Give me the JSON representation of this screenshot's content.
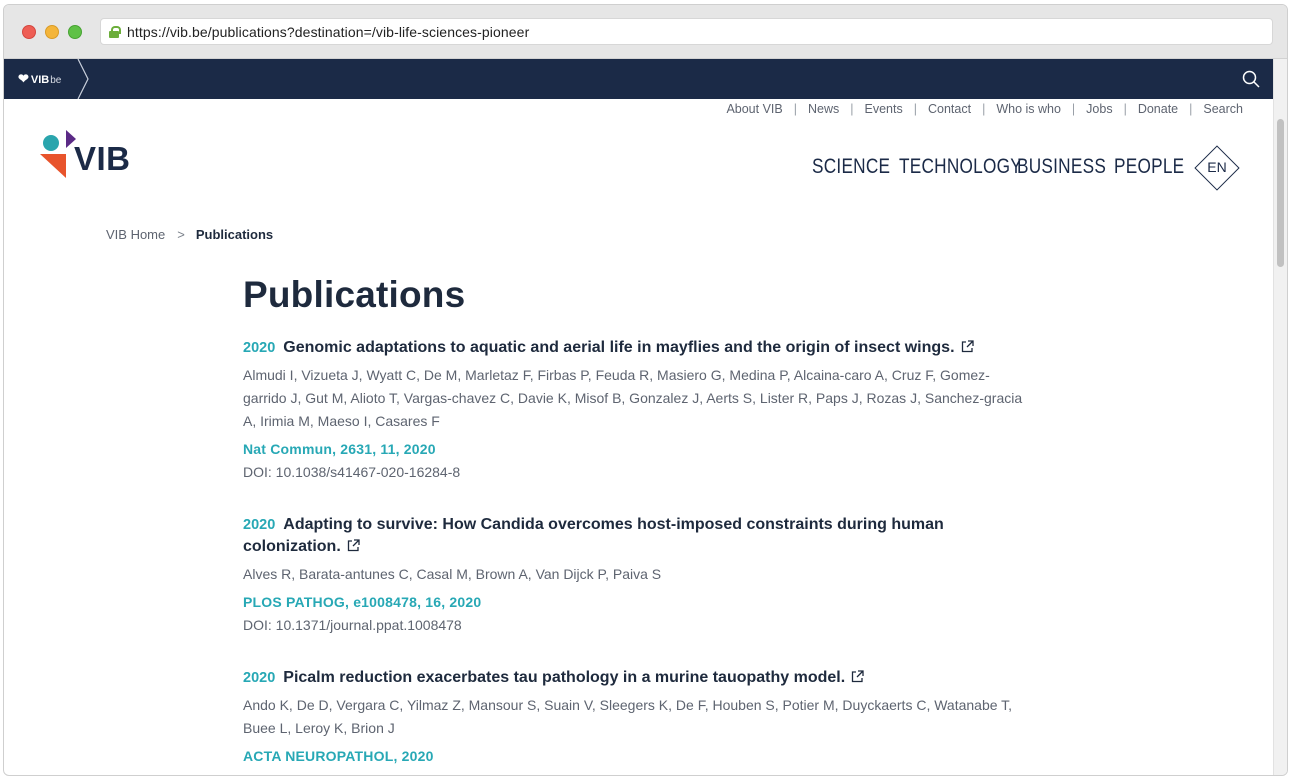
{
  "browser": {
    "url": "https://vib.be/publications?destination=/vib-life-sciences-pioneer"
  },
  "topbar": {
    "site_mark": "VIB",
    "site_suffix": "be",
    "bg_color": "#1b2a47"
  },
  "utility_nav": [
    "About VIB",
    "News",
    "Events",
    "Contact",
    "Who is who",
    "Jobs",
    "Donate",
    "Search"
  ],
  "logo_text": "VIB",
  "main_nav": [
    "SCIENCE",
    "TECHNOLOGY",
    "BUSINESS",
    "PEOPLE"
  ],
  "language": "EN",
  "breadcrumb": {
    "home": "VIB Home",
    "separator": ">",
    "current": "Publications"
  },
  "page_title": "Publications",
  "accent_color": "#27a8b5",
  "publications": [
    {
      "year": "2020",
      "title": "Genomic adaptations to aquatic and aerial life in mayflies and the origin of insect wings.",
      "authors": "Almudi I, Vizueta J, Wyatt C, De M, Marletaz F, Firbas P, Feuda R, Masiero G, Medina P, Alcaina-caro A, Cruz F, Gomez-garrido J, Gut M, Alioto T, Vargas-chavez C, Davie K, Misof B, Gonzalez J, Aerts S, Lister R, Paps J, Rozas J, Sanchez-gracia A, Irimia M, Maeso I, Casares F",
      "journal": "Nat Commun, 2631, 11, 2020",
      "doi": "DOI: 10.1038/s41467-020-16284-8"
    },
    {
      "year": "2020",
      "title": "Adapting to survive: How Candida overcomes host-imposed constraints during human colonization.",
      "authors": "Alves R, Barata-antunes C, Casal M, Brown A, Van Dijck P, Paiva S",
      "journal": "PLOS PATHOG, e1008478, 16, 2020",
      "doi": "DOI: 10.1371/journal.ppat.1008478"
    },
    {
      "year": "2020",
      "title": "Picalm reduction exacerbates tau pathology in a murine tauopathy model.",
      "authors": "Ando K, De D, Vergara C, Yilmaz Z, Mansour S, Suain V, Sleegers K, De F, Houben S, Potier M, Duyckaerts C, Watanabe T, Buee L, Leroy K, Brion J",
      "journal": "ACTA NEUROPATHOL, 2020",
      "doi": ""
    }
  ]
}
